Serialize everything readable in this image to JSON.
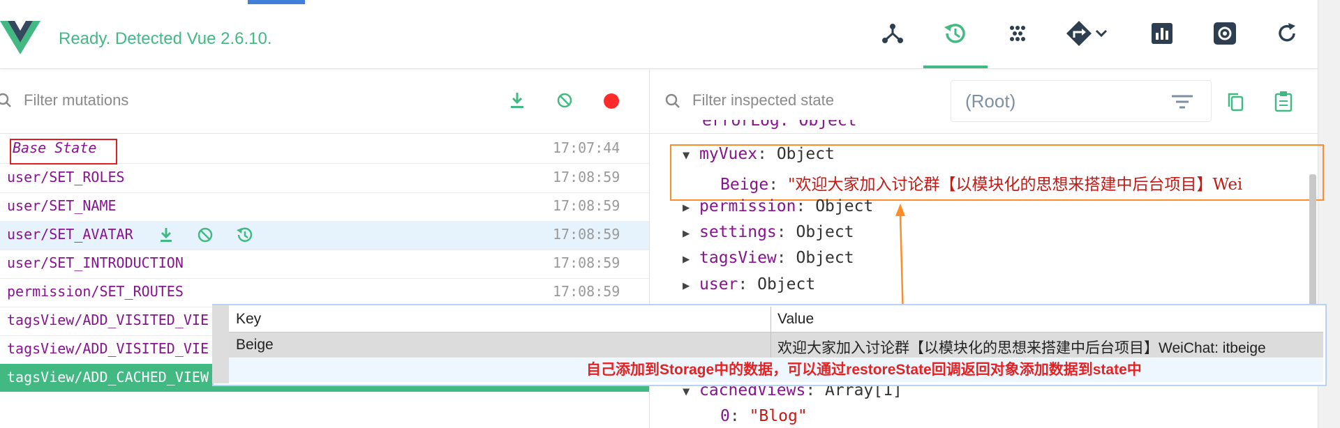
{
  "header": {
    "status": "Ready. Detected Vue 2.6.10."
  },
  "toolbar": {
    "filter_mutations_placeholder": "Filter mutations",
    "filter_state_placeholder": "Filter inspected state",
    "root_select": "(Root)"
  },
  "mutations": [
    {
      "name": "Base State",
      "time": "17:07:44"
    },
    {
      "name": "user/SET_ROLES",
      "time": "17:08:59"
    },
    {
      "name": "user/SET_NAME",
      "time": "17:08:59"
    },
    {
      "name": "user/SET_AVATAR",
      "time": "17:08:59"
    },
    {
      "name": "user/SET_INTRODUCTION",
      "time": "17:08:59"
    },
    {
      "name": "permission/SET_ROUTES",
      "time": "17:08:59"
    },
    {
      "name": "tagsView/ADD_VISITED_VIE",
      "time": ""
    },
    {
      "name": "tagsView/ADD_VISITED_VIE",
      "time": ""
    },
    {
      "name": "tagsView/ADD_CACHED_VIEW",
      "time": ""
    }
  ],
  "state": {
    "errorlog_partial": "errorLog: Object",
    "myvuex_key": "myVuex",
    "myvuex_type": "Object",
    "beige_key": "Beige",
    "beige_value": "\"欢迎大家加入讨论群【以模块化的思想来搭建中后台项目】Wei",
    "permission_key": "permission",
    "settings_key": "settings",
    "tagsview_key": "tagsView",
    "user_key": "user",
    "cachedviews_key": "cachedViews",
    "cachedviews_type": "Array[1]",
    "index_key": "0",
    "index_value": "\"Blog\"",
    "object_type": "Object",
    "colon": ":"
  },
  "tooltip": {
    "key_header": "Key",
    "value_header": "Value",
    "row_key": "Beige",
    "row_value": "欢迎大家加入讨论群【以模块化的思想来搭建中后台项目】WeiChat: itbeige"
  },
  "annotation": "自己添加到Storage中的数据，可以通过restoreState回调返回对象添加数据到state中",
  "colors": {
    "accent": "#42b983",
    "selected_row": "#e6f3fd",
    "active_row": "#42b983",
    "record": "#ff2a2a",
    "annotation": "#e52222",
    "highlight_box": "#ff8c28"
  }
}
